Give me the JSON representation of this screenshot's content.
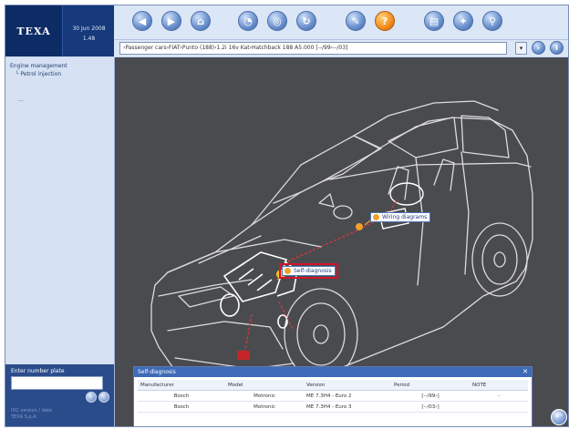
{
  "header": {
    "logo": "TEXA",
    "date": "30 Jun 2008",
    "time": "1.48"
  },
  "toolbar": {
    "buttons": [
      "back",
      "forward",
      "home",
      "clock",
      "globe",
      "refresh",
      "wrench",
      "help",
      "print",
      "settings",
      "search"
    ]
  },
  "path": {
    "value": "›Passenger cars›FIAT›Punto (188)›1.2i 16v Kat›Hatchback 188 A5.000 [‑‑/99›‑‑/03]",
    "dropdown": "▾"
  },
  "sidebar": {
    "tree_root": "Engine management",
    "tree_child": "Petrol injection",
    "tree_placeholder": "—",
    "plate_label": "Enter number plate",
    "footer_1": "IDC version / date",
    "footer_2": "TEXA S.p.A."
  },
  "callouts": {
    "wiring": "Wiring diagrams",
    "self": "Self‑diagnosis"
  },
  "panel": {
    "title": "Self‑diagnosis",
    "close": "✕",
    "columns": [
      "Manufacturer",
      "Model",
      "Version",
      "Period",
      "NOTE"
    ],
    "rows": [
      [
        "Bosch",
        "Motronic",
        "ME 7.3H4 ‑ Euro 2",
        "[‑‑/99›]",
        "‑"
      ],
      [
        "Bosch",
        "Motronic",
        "ME 7.3H4 ‑ Euro 3",
        "[‑‑/03›]",
        ""
      ]
    ]
  },
  "colors": {
    "header_dark": "#0d2c66",
    "sidebar": "#d6e2f4",
    "main_bg": "#4a4b4f",
    "accent": "#d2142c",
    "panel_title": "#3e6bb7"
  }
}
